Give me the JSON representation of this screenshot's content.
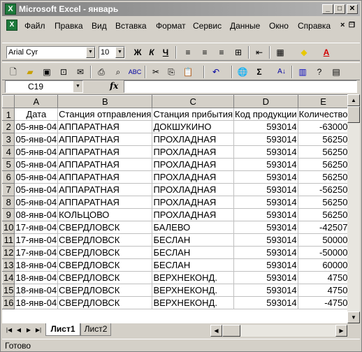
{
  "window": {
    "title": "Microsoft Excel - январь"
  },
  "menu": [
    "Файл",
    "Правка",
    "Вид",
    "Вставка",
    "Формат",
    "Сервис",
    "Данные",
    "Окно",
    "Справка"
  ],
  "format_toolbar": {
    "font": "Arial Cyr",
    "size": "10",
    "bold": "Ж",
    "italic": "К",
    "underline": "Ч"
  },
  "formula_bar": {
    "cell_ref": "C19",
    "fx": "fx",
    "value": ""
  },
  "columns": [
    "A",
    "B",
    "C",
    "D",
    "E"
  ],
  "header_row": {
    "num": "1",
    "cells": [
      "Дата",
      "Станция отправления",
      "Станция прибытия",
      "Код продукции",
      "Количество"
    ]
  },
  "rows": [
    {
      "num": "2",
      "date": "05-янв-04",
      "from": "АППАРАТНАЯ",
      "to": "ДОКШУКИНО",
      "code": "593014",
      "qty": "-63000"
    },
    {
      "num": "3",
      "date": "05-янв-04",
      "from": "АППАРАТНАЯ",
      "to": "ПРОХЛАДНАЯ",
      "code": "593014",
      "qty": "56250"
    },
    {
      "num": "4",
      "date": "05-янв-04",
      "from": "АППАРАТНАЯ",
      "to": "ПРОХЛАДНАЯ",
      "code": "593014",
      "qty": "56250"
    },
    {
      "num": "5",
      "date": "05-янв-04",
      "from": "АППАРАТНАЯ",
      "to": "ПРОХЛАДНАЯ",
      "code": "593014",
      "qty": "56250"
    },
    {
      "num": "6",
      "date": "05-янв-04",
      "from": "АППАРАТНАЯ",
      "to": "ПРОХЛАДНАЯ",
      "code": "593014",
      "qty": "56250"
    },
    {
      "num": "7",
      "date": "05-янв-04",
      "from": "АППАРАТНАЯ",
      "to": "ПРОХЛАДНАЯ",
      "code": "593014",
      "qty": "-56250"
    },
    {
      "num": "8",
      "date": "05-янв-04",
      "from": "АППАРАТНАЯ",
      "to": "ПРОХЛАДНАЯ",
      "code": "593014",
      "qty": "56250"
    },
    {
      "num": "9",
      "date": "08-янв-04",
      "from": "КОЛЬЦОВО",
      "to": "ПРОХЛАДНАЯ",
      "code": "593014",
      "qty": "56250"
    },
    {
      "num": "10",
      "date": "17-янв-04",
      "from": "СВЕРДЛОВСК",
      "to": "БАЛЕВО",
      "code": "593014",
      "qty": "-42507"
    },
    {
      "num": "11",
      "date": "17-янв-04",
      "from": "СВЕРДЛОВСК",
      "to": "БЕСЛАН",
      "code": "593014",
      "qty": "50000"
    },
    {
      "num": "12",
      "date": "17-янв-04",
      "from": "СВЕРДЛОВСК",
      "to": "БЕСЛАН",
      "code": "593014",
      "qty": "-50000"
    },
    {
      "num": "13",
      "date": "18-янв-04",
      "from": "СВЕРДЛОВСК",
      "to": "БЕСЛАН",
      "code": "593014",
      "qty": "60000"
    },
    {
      "num": "14",
      "date": "18-янв-04",
      "from": "СВЕРДЛОВСК",
      "to": "ВЕРХНЕКОНД.",
      "code": "593014",
      "qty": "4750"
    },
    {
      "num": "15",
      "date": "18-янв-04",
      "from": "СВЕРДЛОВСК",
      "to": "ВЕРХНЕКОНД.",
      "code": "593014",
      "qty": "4750"
    },
    {
      "num": "16",
      "date": "18-янв-04",
      "from": "СВЕРДЛОВСК",
      "to": "ВЕРХНЕКОНД.",
      "code": "593014",
      "qty": "-4750"
    }
  ],
  "sheets": [
    {
      "name": "Лист1",
      "active": true
    },
    {
      "name": "Лист2",
      "active": false
    }
  ],
  "status": "Готово"
}
